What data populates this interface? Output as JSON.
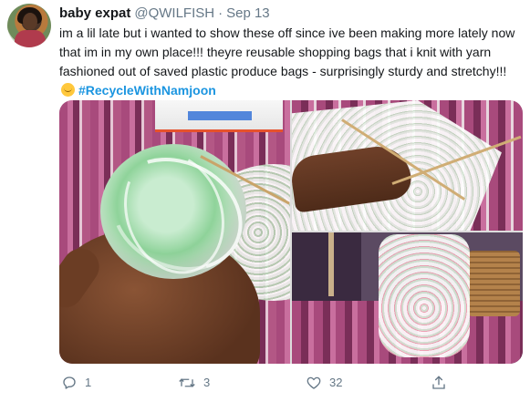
{
  "user": {
    "display_name": "baby expat",
    "handle": "@QWILFISH",
    "separator": "·",
    "date": "Sep 13"
  },
  "tweet": {
    "text": "im a lil late but i wanted to show these off since ive been making more lately now that im in my own place!!! theyre reusable shopping bags that i knit with yarn fashioned out of saved plastic produce bags - surprisingly sturdy and stretchy!!!",
    "emoji": "hugging-face-icon",
    "hashtag": "#RecycleWithNamjoon"
  },
  "media": {
    "photos": [
      "hand holding ball of plastic yarn",
      "knitting needles with plastic yarn lace",
      "knitted mesh shopping bag"
    ]
  },
  "actions": {
    "reply_count": "1",
    "retweet_count": "3",
    "like_count": "32"
  },
  "colors": {
    "link": "#1b95e0",
    "text": "#14171a",
    "muted": "#657786"
  }
}
